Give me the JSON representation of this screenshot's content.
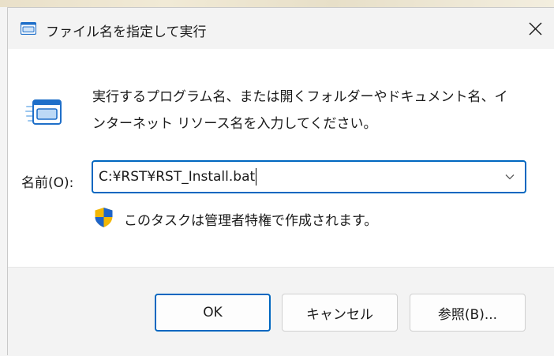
{
  "window": {
    "title": "ファイル名を指定して実行",
    "title_icon": "run-dialog-icon",
    "close_icon": "close-icon"
  },
  "content": {
    "description_line1": "実行するプログラム名、または開くフォルダーやドキュメント名、イ",
    "description_line2": "ンターネット リソース名を入力してください。",
    "name_label": "名前(O):",
    "name_value": "C:¥RST¥RST_Install.bat",
    "dropdown_icon": "chevron-down-icon",
    "admin_icon": "uac-shield-icon",
    "admin_note": "このタスクは管理者特権で作成されます。"
  },
  "buttons": {
    "ok": "OK",
    "cancel": "キャンセル",
    "browse": "参照(B)..."
  },
  "colors": {
    "accent": "#0067c0",
    "shield_blue": "#1e64c8",
    "shield_yellow": "#f2b705"
  }
}
